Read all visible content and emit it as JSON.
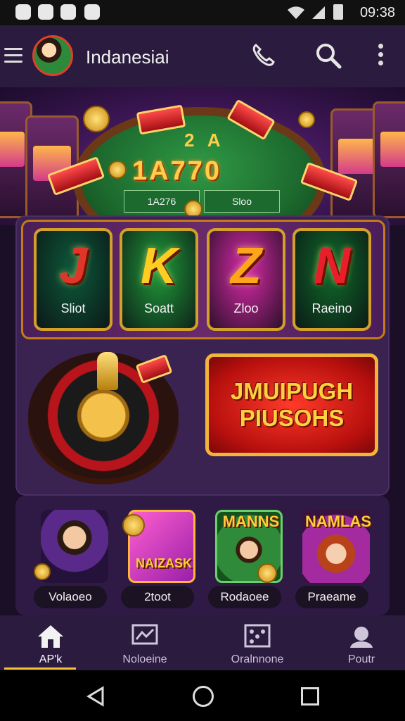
{
  "status_bar": {
    "time": "09:38"
  },
  "app_bar": {
    "title": "Indanesiai"
  },
  "hero": {
    "top_letters": "2 A",
    "digits": "1A770",
    "cells": [
      "1A276",
      "Sloo"
    ]
  },
  "game_tiles": [
    {
      "glyph": "J",
      "label": "Sliot",
      "color": "#e0362a",
      "bg": "#0d5a3a"
    },
    {
      "glyph": "K",
      "label": "Soatt",
      "color": "#ffcc22",
      "bg": "#1f9a3a"
    },
    {
      "glyph": "Z",
      "label": "Zloo",
      "color": "#ffa51a",
      "bg": "#d82aa8"
    },
    {
      "glyph": "N",
      "label": "Raeino",
      "color": "#e81e2a",
      "bg": "#0f6a2a"
    }
  ],
  "jackpot": {
    "line1": "JMUIPUGH",
    "line2": "PIUSOHS"
  },
  "featured": [
    {
      "label": "Volaoeo",
      "title": ""
    },
    {
      "label": "2toot",
      "title": "NAIZASK"
    },
    {
      "label": "Rodaoee",
      "title": "MANNS"
    },
    {
      "label": "Praeame",
      "title": "NAMLAS"
    }
  ],
  "bottom_nav": [
    {
      "label": "AP'k",
      "icon": "home-icon"
    },
    {
      "label": "Noloeine",
      "icon": "chart-icon"
    },
    {
      "label": "Oralnnone",
      "icon": "dice-icon"
    },
    {
      "label": "Poutr",
      "icon": "profile-icon"
    }
  ]
}
